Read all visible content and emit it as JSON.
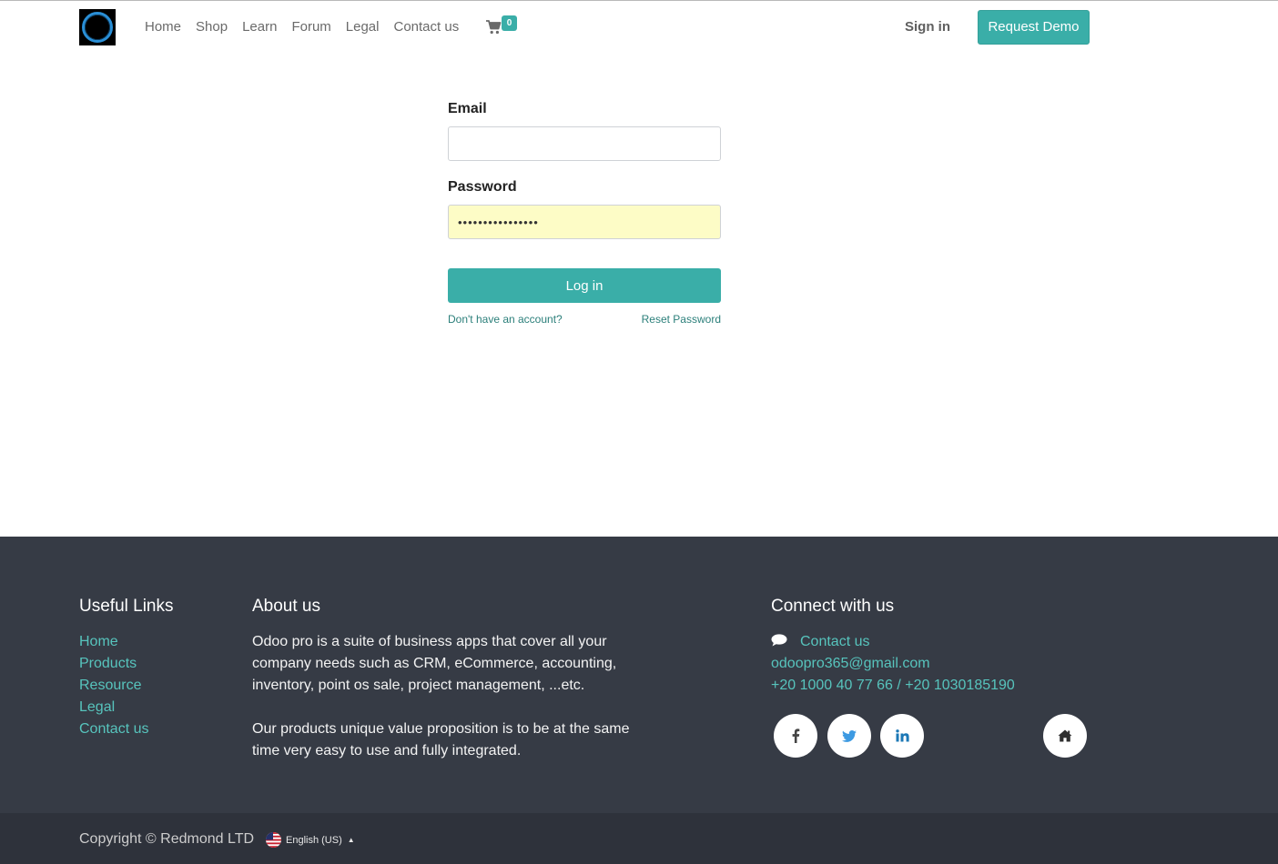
{
  "header": {
    "nav": [
      "Home",
      "Shop",
      "Learn",
      "Forum",
      "Legal",
      "Contact us"
    ],
    "cart_count": "0",
    "sign_in": "Sign in",
    "request_demo": "Request Demo"
  },
  "login": {
    "email_label": "Email",
    "email_value": "",
    "password_label": "Password",
    "password_value": "••••••••••••••••",
    "login_button": "Log in",
    "signup_link": "Don't have an account?",
    "reset_link": "Reset Password"
  },
  "footer": {
    "useful_links_title": "Useful Links",
    "useful_links": [
      "Home",
      "Products",
      "Resource",
      "Legal",
      "Contact us"
    ],
    "about_title": "About us",
    "about_p1": "Odoo pro is a suite of business apps that cover all your company needs such as CRM, eCommerce, accounting, inventory, point os sale, project management, ...etc.",
    "about_p2": "Our products unique value proposition is to be at the same time very easy to use and fully integrated.",
    "connect_title": "Connect with us",
    "contact_link": "Contact us",
    "email": "odoopro365@gmail.com",
    "phone": "+20 1000 40 77 66 / +20 1030185190",
    "social_icons": [
      "facebook-icon",
      "twitter-icon",
      "linkedin-icon",
      "home-icon"
    ]
  },
  "bottom": {
    "copyright": "Copyright © Redmond LTD",
    "language": "English (US)"
  },
  "colors": {
    "accent": "#3aaea8",
    "footer_bg": "#363b45",
    "bottom_bg": "#2e323b",
    "link": "#57c4bd"
  }
}
